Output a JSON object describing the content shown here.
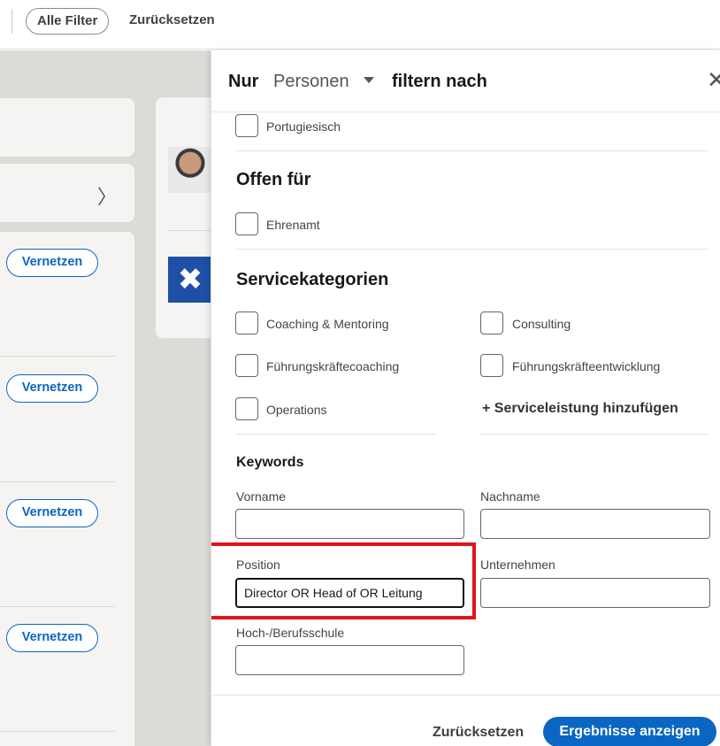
{
  "topbar": {
    "all_filters": "Alle Filter",
    "reset": "Zurücksetzen"
  },
  "background": {
    "connect_label": "Vernetzen",
    "logo_glyph": "✖"
  },
  "panel": {
    "header": {
      "prefix": "Nur",
      "selected_type": "Personen",
      "suffix": "filtern nach",
      "close_glyph": "✕"
    },
    "languages": {
      "items": [
        {
          "label": "Portugiesisch",
          "checked": false
        }
      ]
    },
    "open_for": {
      "title": "Offen für",
      "items": [
        {
          "label": "Ehrenamt",
          "checked": false
        }
      ]
    },
    "service_categories": {
      "title": "Servicekategorien",
      "items": [
        {
          "label": "Coaching & Mentoring",
          "checked": false
        },
        {
          "label": "Consulting",
          "checked": false
        },
        {
          "label": "Führungskräftecoaching",
          "checked": false
        },
        {
          "label": "Führungskräfteentwicklung",
          "checked": false
        },
        {
          "label": "Operations",
          "checked": false
        }
      ],
      "add_label": "+ Serviceleistung hinzufügen"
    },
    "keywords": {
      "title": "Keywords",
      "first_name": {
        "label": "Vorname",
        "value": ""
      },
      "last_name": {
        "label": "Nachname",
        "value": ""
      },
      "position": {
        "label": "Position",
        "value": "Director OR Head of OR Leitung"
      },
      "company": {
        "label": "Unternehmen",
        "value": ""
      },
      "school": {
        "label": "Hoch-/Berufsschule",
        "value": ""
      }
    },
    "footer": {
      "reset": "Zurücksetzen",
      "apply": "Ergebnisse anzeigen"
    }
  },
  "colors": {
    "accent": "#0a66c2",
    "highlight": "#e0141b"
  }
}
